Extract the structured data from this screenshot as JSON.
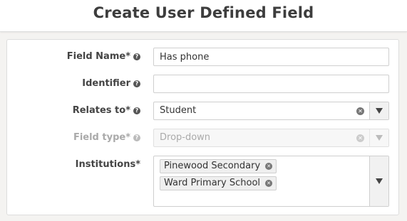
{
  "header": {
    "title": "Create User Defined Field"
  },
  "form": {
    "field_name": {
      "label": "Field Name*",
      "value": "Has phone"
    },
    "identifier": {
      "label": "Identifier",
      "value": ""
    },
    "relates_to": {
      "label": "Relates to*",
      "value": "Student"
    },
    "field_type": {
      "label": "Field type*",
      "value": "Drop-down",
      "disabled": true
    },
    "institutions": {
      "label": "Institutions*",
      "tags": [
        "Pinewood Secondary",
        "Ward Primary School"
      ]
    }
  }
}
